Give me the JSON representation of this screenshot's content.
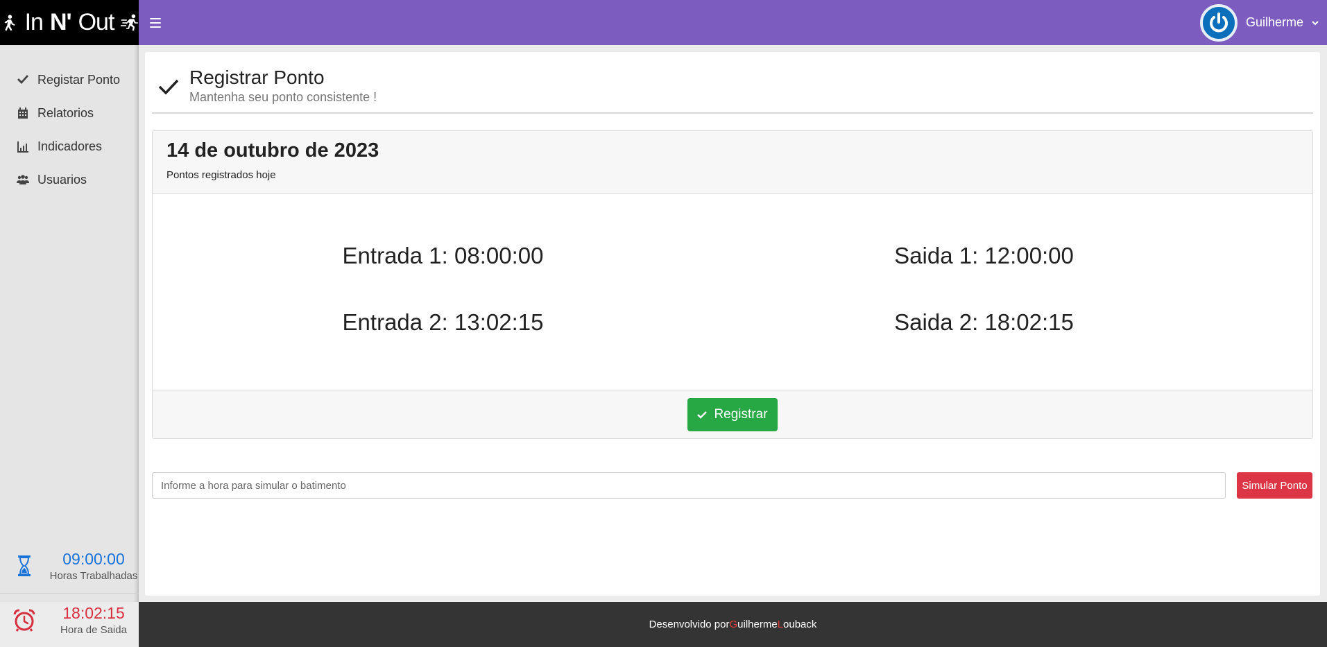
{
  "brand": {
    "prefix": "In",
    "bold": "N'",
    "suffix": "Out"
  },
  "header": {
    "user_name": "Guilherme"
  },
  "sidebar": {
    "items": [
      {
        "label": "Registar Ponto",
        "icon": "check-icon"
      },
      {
        "label": "Relatorios",
        "icon": "calendar-icon"
      },
      {
        "label": "Indicadores",
        "icon": "chart-icon"
      },
      {
        "label": "Usuarios",
        "icon": "users-icon"
      }
    ],
    "hours_value": "09:00:00",
    "hours_label": "Horas Trabalhadas",
    "exit_value": "18:02:15",
    "exit_label": "Hora de Saida"
  },
  "page": {
    "title": "Registrar Ponto",
    "subtitle": "Mantenha seu ponto consistente !"
  },
  "panel": {
    "date": "14 de outubro de 2023",
    "caption": "Pontos registrados hoje",
    "entries": [
      "Entrada 1: 08:00:00",
      "Saida 1: 12:00:00",
      "Entrada 2: 13:02:15",
      "Saida 2: 18:02:15"
    ],
    "register_label": "Registrar"
  },
  "simulate": {
    "placeholder": "Informe a hora para simular o batimento",
    "button_label": "Simular Ponto"
  },
  "footer": {
    "prefix": "Desenvolvido por ",
    "first_initial": "G",
    "first_rest": "uilherme ",
    "last_initial": "L",
    "last_rest": "ouback"
  },
  "colors": {
    "topbar": "#7c5cbf",
    "success": "#28a745",
    "danger": "#dc3545",
    "hours": "#1a73d9",
    "exit": "#d6303f"
  }
}
